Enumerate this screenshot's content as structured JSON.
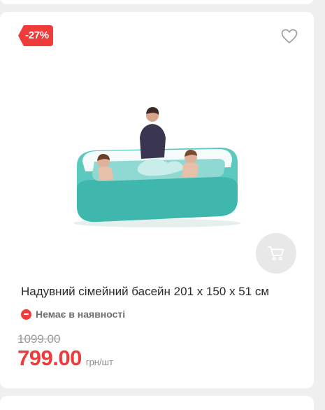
{
  "product": {
    "discount_badge": "-27%",
    "title": "Надувний сімейний басейн 201 x 150 x 51 см",
    "availability": "Немає в наявності",
    "old_price": "1099.00",
    "current_price": "799.00",
    "unit": "грн/шт"
  },
  "icons": {
    "favorite": "heart-outline-icon",
    "cart": "shopping-cart-icon",
    "availability": "minus-circle-icon"
  },
  "colors": {
    "accent": "#f03b3b",
    "cart_button_bg": "#e8e8e8",
    "page_bg": "#efefef"
  }
}
